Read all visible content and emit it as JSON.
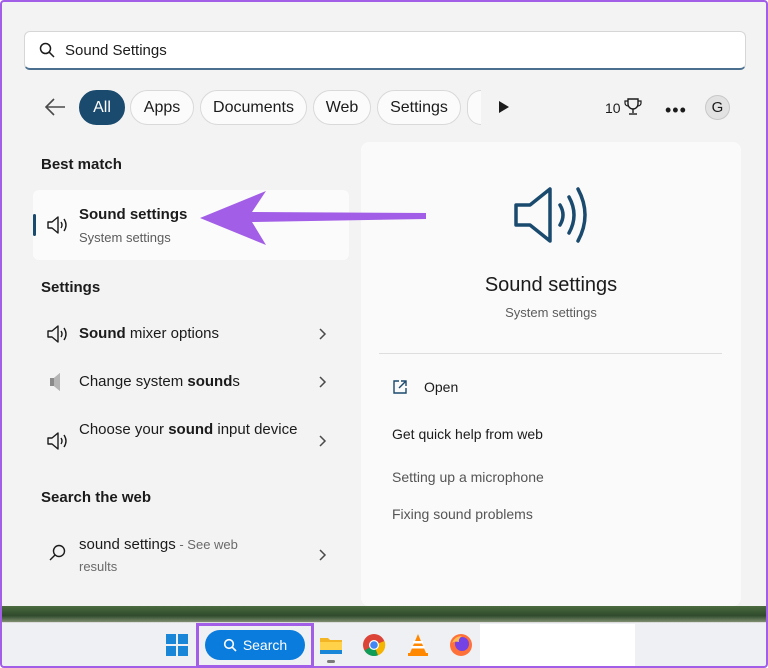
{
  "search": {
    "query": "Sound Settings"
  },
  "filters": {
    "chips": [
      "All",
      "Apps",
      "Documents",
      "Web",
      "Settings"
    ],
    "count": "10",
    "avatar_letter": "G"
  },
  "left": {
    "best_match_title": "Best match",
    "best_match": {
      "title": "Sound settings",
      "subtitle": "System settings"
    },
    "settings_title": "Settings",
    "settings_items": [
      {
        "pre": "",
        "bold": "Sound",
        "post": " mixer options"
      },
      {
        "pre": "Change system ",
        "bold": "sound",
        "post": "s"
      },
      {
        "pre": "Choose your ",
        "bold": "sound",
        "post": " input device"
      }
    ],
    "web_title": "Search the web",
    "web_item": {
      "query": "sound settings",
      "suffix": " - See web results"
    }
  },
  "right": {
    "title": "Sound settings",
    "subtitle": "System settings",
    "open_label": "Open",
    "help_title": "Get quick help from web",
    "help_links": [
      "Setting up a microphone",
      "Fixing sound problems"
    ]
  },
  "taskbar": {
    "search_label": "Search"
  },
  "colors": {
    "accent": "#1a4a6e",
    "annotation": "#a25ee6",
    "taskbar_search": "#0a7cde"
  }
}
